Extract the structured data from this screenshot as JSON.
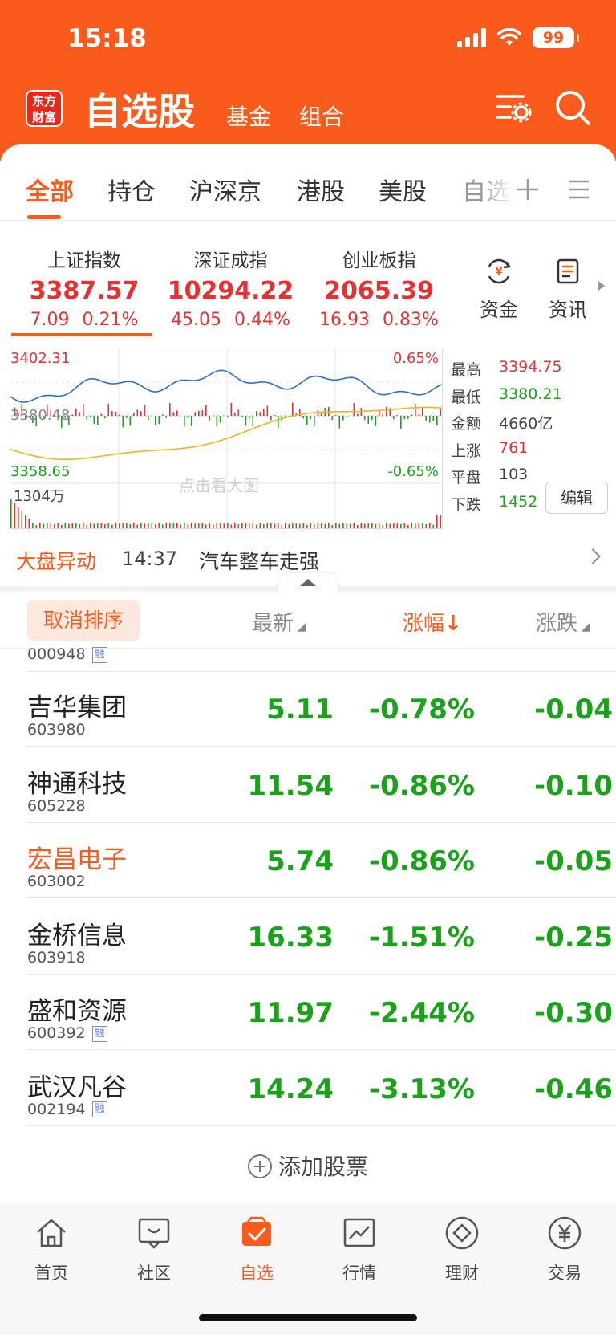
{
  "status": {
    "time": "15:18",
    "battery": "99"
  },
  "header": {
    "logo_top": "东方",
    "logo_bottom": "财富",
    "title": "自选股",
    "sub_tabs": [
      "基金",
      "组合"
    ]
  },
  "tabs": [
    "全部",
    "持仓",
    "沪深京",
    "港股",
    "美股",
    "自选"
  ],
  "indices": [
    {
      "name": "上证指数",
      "value": "3387.57",
      "change": "7.09",
      "pct": "0.21%"
    },
    {
      "name": "深证成指",
      "value": "10294.22",
      "change": "45.05",
      "pct": "0.44%"
    },
    {
      "name": "创业板指",
      "value": "2065.39",
      "change": "16.93",
      "pct": "0.83%"
    }
  ],
  "side_buttons": {
    "capital": "资金",
    "news": "资讯"
  },
  "mini_chart": {
    "high_label": "3402.31",
    "mid_label": "3380.48",
    "low_label": "3358.65",
    "high_pct": "0.65%",
    "low_pct": "-0.65%",
    "volume_label": "1304万",
    "watermark": "点击看大图",
    "colors": {
      "price": "#2d6ec9",
      "avg": "#f5b21c",
      "up": "#e93030",
      "down": "#1aa31a"
    }
  },
  "market_stats": [
    {
      "label": "最高",
      "value": "3394.75",
      "color": "#e93030"
    },
    {
      "label": "最低",
      "value": "3380.21",
      "color": "#1aa31a"
    },
    {
      "label": "金额",
      "value": "4660亿",
      "color": "#444444"
    },
    {
      "label": "上涨",
      "value": "761",
      "color": "#e93030"
    },
    {
      "label": "平盘",
      "value": "103",
      "color": "#444444"
    },
    {
      "label": "下跌",
      "value": "1452",
      "color": "#1aa31a"
    }
  ],
  "edit_label": "编辑",
  "alert": {
    "tag": "大盘异动",
    "time": "14:37",
    "message": "汽车整车走强"
  },
  "list_header": {
    "cancel_sort": "取消排序",
    "latest": "最新",
    "change_pct": "涨幅",
    "change": "涨跌"
  },
  "partial_row": {
    "code": "000948",
    "badge": "融"
  },
  "stocks": [
    {
      "name": "吉华集团",
      "code": "603980",
      "price": "5.11",
      "pct": "-0.78%",
      "change": "-0.04",
      "badge": ""
    },
    {
      "name": "神通科技",
      "code": "605228",
      "price": "11.54",
      "pct": "-0.86%",
      "change": "-0.10",
      "badge": ""
    },
    {
      "name": "宏昌电子",
      "code": "603002",
      "price": "5.74",
      "pct": "-0.86%",
      "change": "-0.05",
      "badge": ""
    },
    {
      "name": "金桥信息",
      "code": "603918",
      "price": "16.33",
      "pct": "-1.51%",
      "change": "-0.25",
      "badge": ""
    },
    {
      "name": "盛和资源",
      "code": "600392",
      "price": "11.97",
      "pct": "-2.44%",
      "change": "-0.30",
      "badge": "融"
    },
    {
      "name": "武汉凡谷",
      "code": "002194",
      "price": "14.24",
      "pct": "-3.13%",
      "change": "-0.46",
      "badge": "融"
    }
  ],
  "add_stock": "添加股票",
  "bottom_nav": [
    "首页",
    "社区",
    "自选",
    "行情",
    "理财",
    "交易"
  ],
  "accent_color": "#fb5a1d"
}
